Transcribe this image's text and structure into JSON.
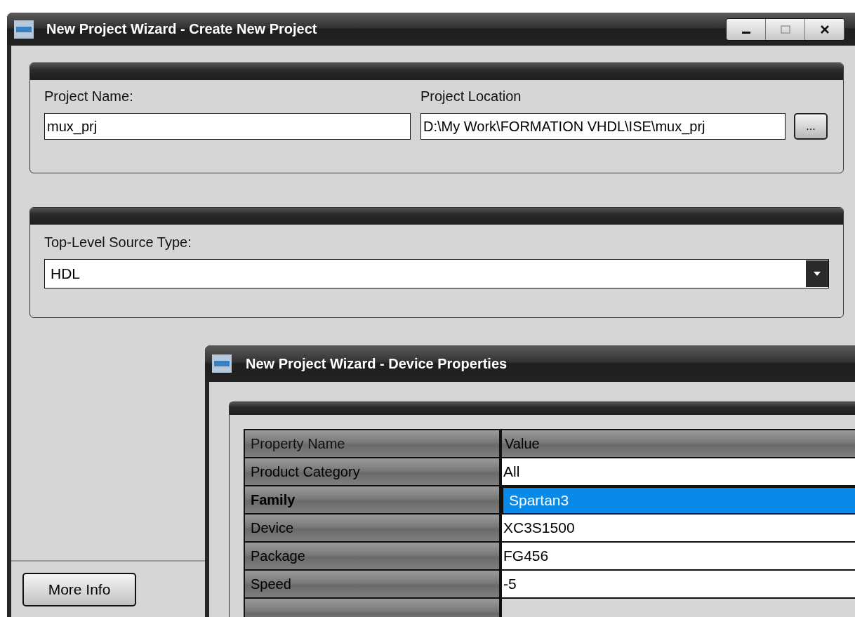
{
  "main_window": {
    "title": "New Project Wizard - Create New Project",
    "project_name": {
      "label": "Project Name:",
      "value": "mux_prj"
    },
    "project_location": {
      "label": "Project Location",
      "value": "D:\\My Work\\FORMATION VHDL\\ISE\\mux_prj",
      "browse_button": "..."
    },
    "source_type": {
      "label": "Top-Level Source Type:",
      "value": "HDL"
    },
    "more_info_button": "More Info"
  },
  "device_window": {
    "title": "New Project Wizard - Device Properties",
    "columns": [
      "Property Name",
      "Value"
    ],
    "rows": [
      {
        "name": "Product Category",
        "value": "All",
        "selected": false,
        "bold": false
      },
      {
        "name": "Family",
        "value": "Spartan3",
        "selected": true,
        "bold": true
      },
      {
        "name": "Device",
        "value": "XC3S1500",
        "selected": false,
        "bold": false
      },
      {
        "name": "Package",
        "value": "FG456",
        "selected": false,
        "bold": false
      },
      {
        "name": "Speed",
        "value": "-5",
        "selected": false,
        "bold": false
      }
    ]
  }
}
